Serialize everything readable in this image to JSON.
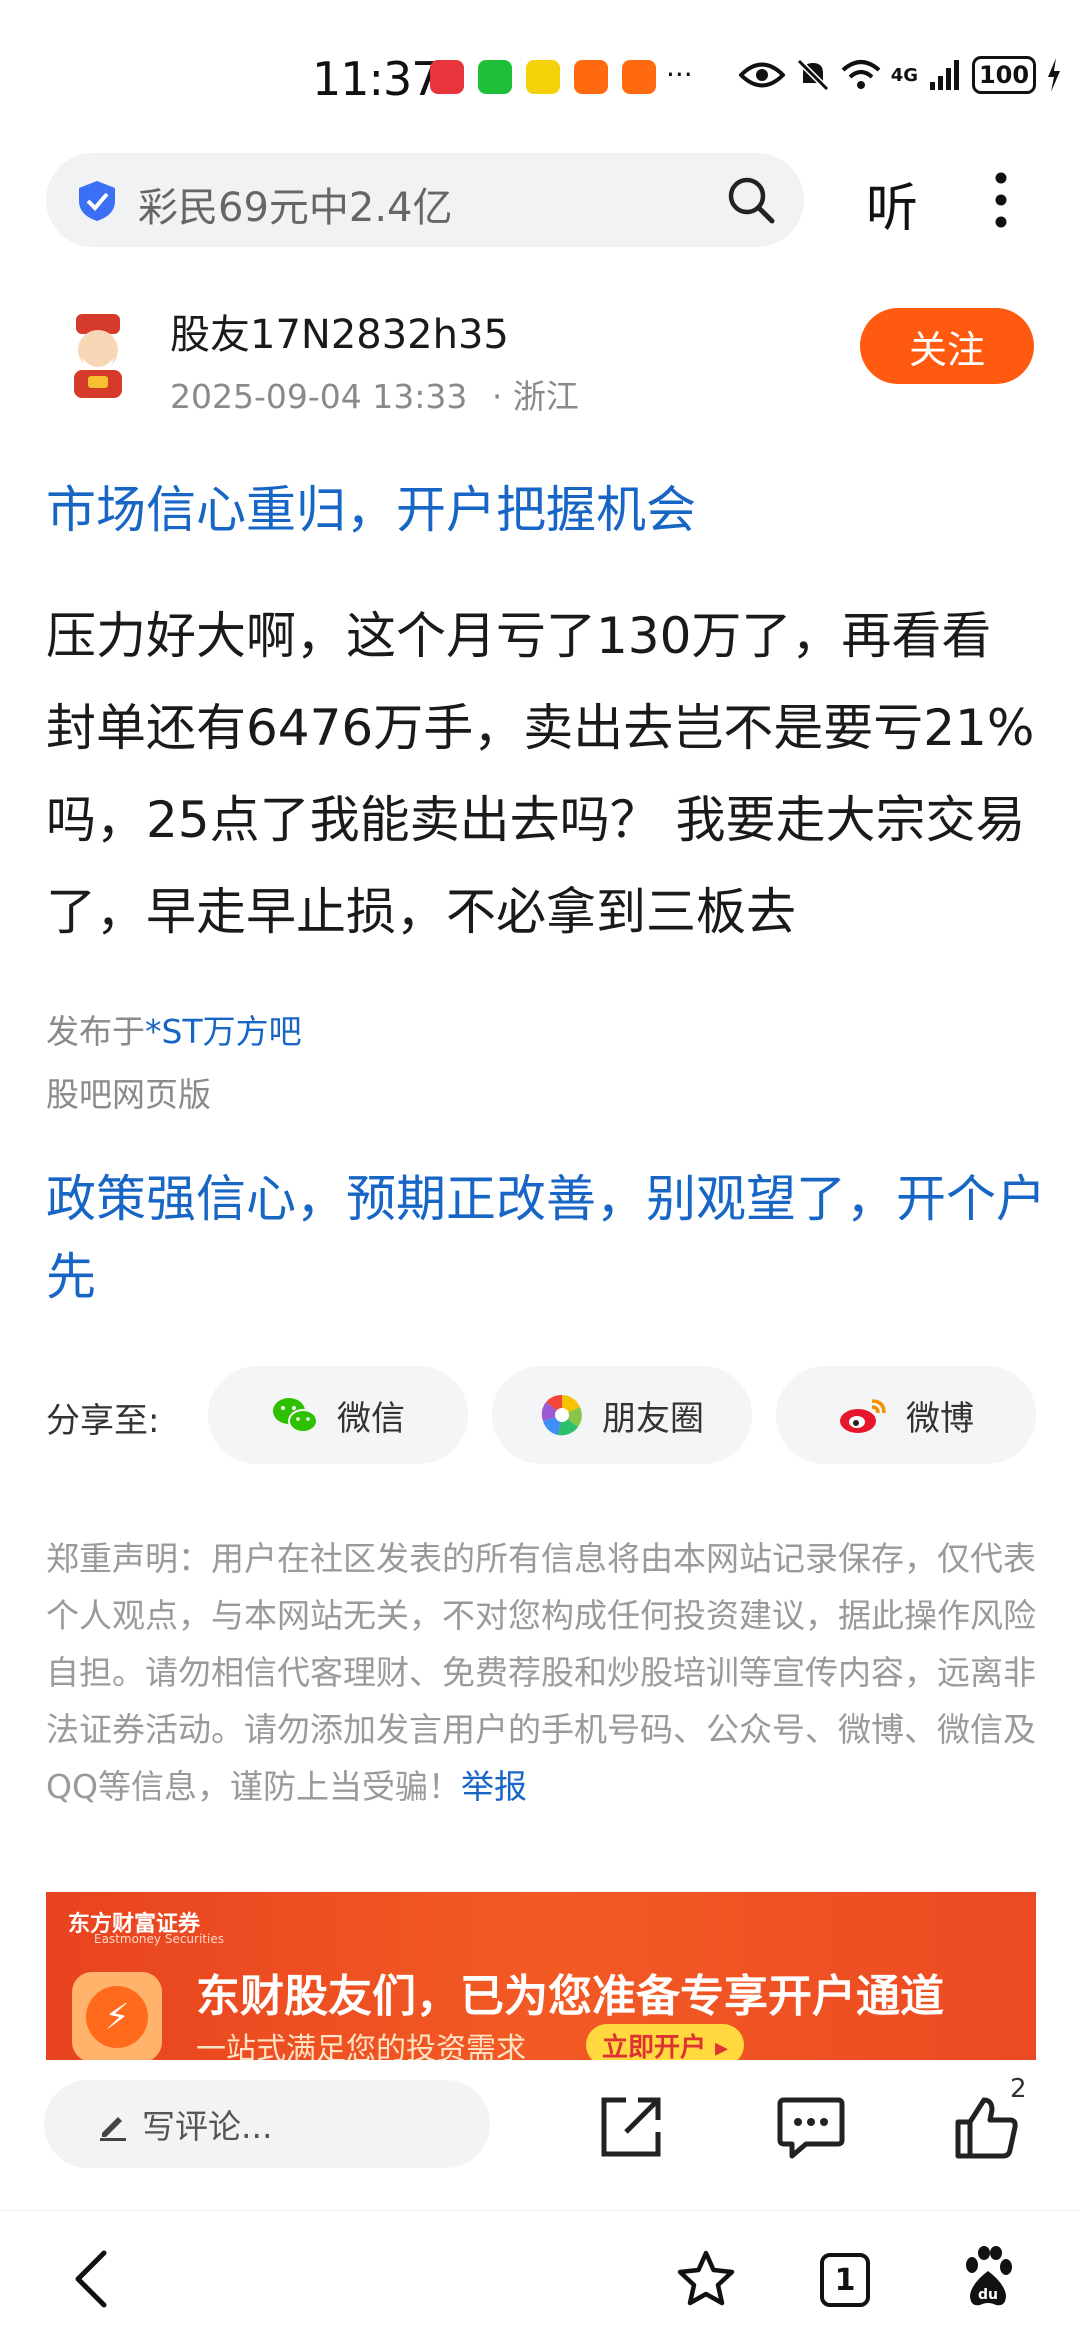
{
  "status_bar": {
    "time": "11:37",
    "ellipsis": "···",
    "battery": "100",
    "network": "4G"
  },
  "search": {
    "query": "彩民69元中2.4亿",
    "listen_label": "听"
  },
  "post": {
    "username": "股友17N2832h35",
    "datetime": "2025-09-04 13:33",
    "location": "· 浙江",
    "follow_label": "关注",
    "ad_title": "市场信心重归，开户把握机会",
    "content": "压力好大啊，这个月亏了130万了，再看看封单还有6476万手，卖出去岂不是要亏21%吗，25点了我能卖出去吗？ 我要走大宗交易了，早走早止损，不必拿到三板去",
    "posted_prefix": "发布于",
    "posted_board": "*ST万方吧",
    "version": "股吧网页版",
    "ad_title_2": "政策强信心，预期正改善，别观望了，开个户先"
  },
  "share": {
    "label": "分享至:",
    "wechat": "微信",
    "moments": "朋友圈",
    "weibo": "微博"
  },
  "disclaimer": {
    "text": "郑重声明：用户在社区发表的所有信息将由本网站记录保存，仅代表个人观点，与本网站无关，不对您构成任何投资建议，据此操作风险自担。请勿相信代客理财、免费荐股和炒股培训等宣传内容，远离非法证券活动。请勿添加发言用户的手机号码、公众号、微博、微信及QQ等信息，谨防上当受骗！",
    "report_label": "举报"
  },
  "banner": {
    "brand": "东方财富证券",
    "brand_en": "Eastmoney Securities",
    "headline": "东财股友们，已为您准备专享开户通道",
    "sub": "一站式满足您的投资需求",
    "cta": "立即开户 ▸"
  },
  "action_bar": {
    "comment_placeholder": "写评论...",
    "like_count": "2"
  },
  "nav_bar": {
    "tabs_count": "1"
  },
  "colors": {
    "accent_blue": "#1766c5",
    "follow_orange": "#ff5a10",
    "banner_red": "#ec4a22"
  }
}
